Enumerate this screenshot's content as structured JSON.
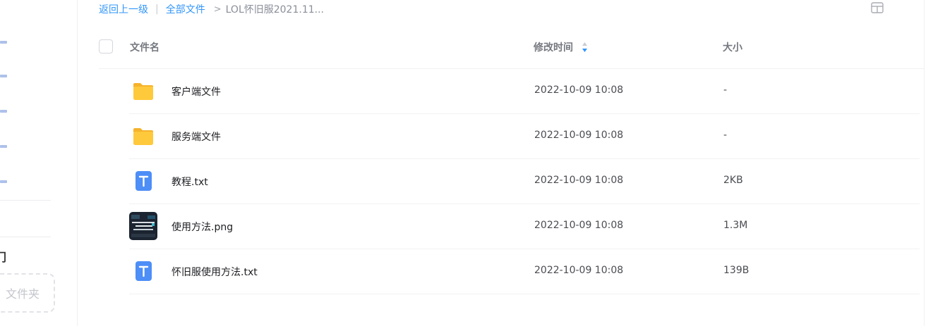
{
  "sidebar": {
    "section_heading": "门",
    "new_folder_label": "文件夹"
  },
  "breadcrumb": {
    "back_label": "返回上一级",
    "separator": "|",
    "all_files_label": "全部文件",
    "arrow": ">",
    "current": "LOL怀旧服2021.11..."
  },
  "table_header": {
    "name": "文件名",
    "modified": "修改时间",
    "size": "大小"
  },
  "files": [
    {
      "name": "客户端文件",
      "modified": "2022-10-09 10:08",
      "size": "-",
      "icon": "folder-icon"
    },
    {
      "name": "服务端文件",
      "modified": "2022-10-09 10:08",
      "size": "-",
      "icon": "folder-icon"
    },
    {
      "name": "教程.txt",
      "modified": "2022-10-09 10:08",
      "size": "2KB",
      "icon": "txt-file-icon"
    },
    {
      "name": "使用方法.png",
      "modified": "2022-10-09 10:08",
      "size": "1.3M",
      "icon": "image-thumbnail"
    },
    {
      "name": "怀旧服使用方法.txt",
      "modified": "2022-10-09 10:08",
      "size": "139B",
      "icon": "txt-file-icon"
    }
  ],
  "colors": {
    "accent": "#3296fa",
    "folder": "#ffc93c",
    "txt_icon": "#4d8ef7"
  }
}
